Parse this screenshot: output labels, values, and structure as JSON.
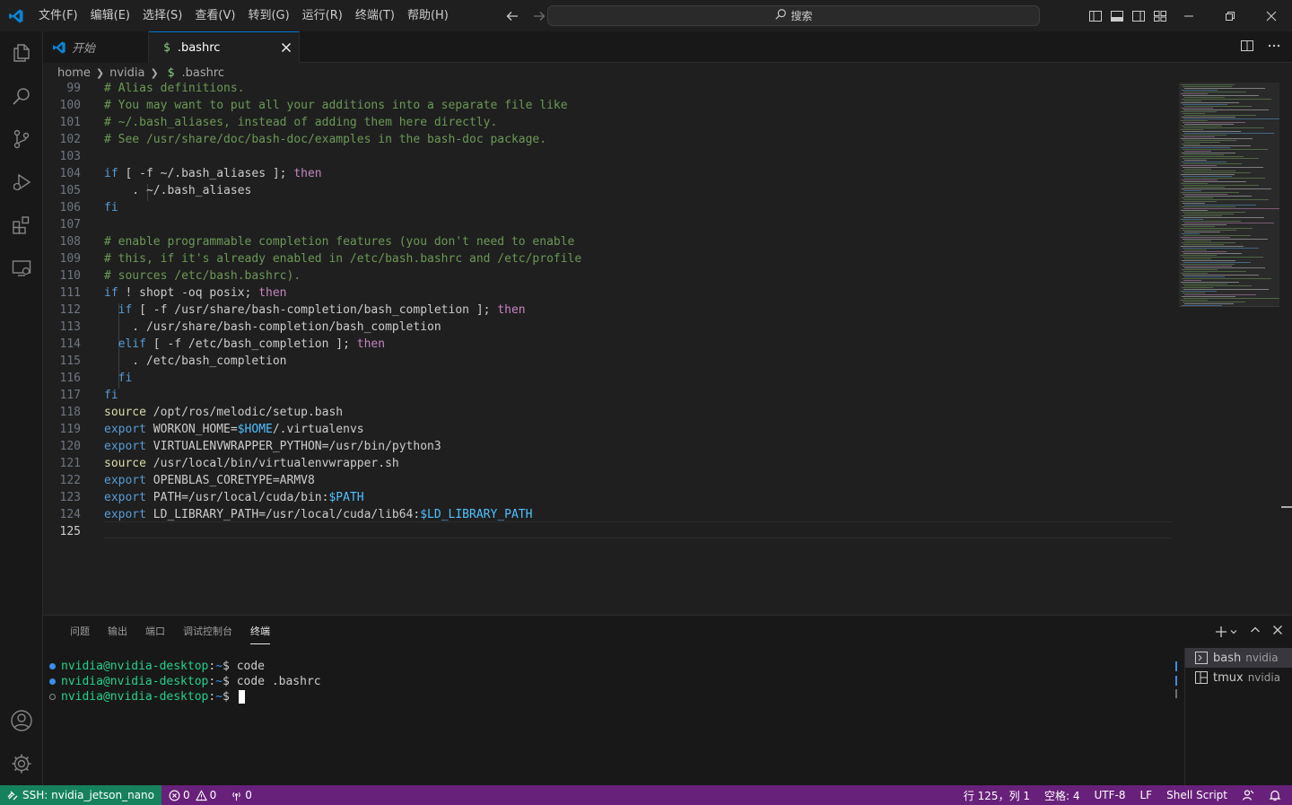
{
  "titlebar": {
    "menu": [
      "文件(F)",
      "编辑(E)",
      "选择(S)",
      "查看(V)",
      "转到(G)",
      "运行(R)",
      "终端(T)",
      "帮助(H)"
    ],
    "search_placeholder": "搜索"
  },
  "tabs": [
    {
      "label": "开始",
      "active": false
    },
    {
      "label": ".bashrc",
      "active": true,
      "icon_text": "$"
    }
  ],
  "breadcrumb": {
    "parts": [
      "home",
      "nvidia",
      ".bashrc"
    ],
    "file_icon": "$"
  },
  "editor": {
    "lines": [
      {
        "n": "99",
        "segs": [
          {
            "t": "# Alias definitions.",
            "c": "c-comment"
          }
        ]
      },
      {
        "n": "100",
        "segs": [
          {
            "t": "# You may want to put all your additions into a separate file like",
            "c": "c-comment"
          }
        ]
      },
      {
        "n": "101",
        "segs": [
          {
            "t": "# ~/.bash_aliases, instead of adding them here directly.",
            "c": "c-comment"
          }
        ]
      },
      {
        "n": "102",
        "segs": [
          {
            "t": "# See /usr/share/doc/bash-doc/examples in the bash-doc package.",
            "c": "c-comment"
          }
        ]
      },
      {
        "n": "103",
        "segs": []
      },
      {
        "n": "104",
        "segs": [
          {
            "t": "if",
            "c": "c-blue"
          },
          {
            "t": " [ -f ~/.bash_aliases ]; ",
            "c": "c-plain"
          },
          {
            "t": "then",
            "c": "c-kw"
          }
        ]
      },
      {
        "n": "105",
        "segs": [
          {
            "t": "    . ~/.bash_aliases",
            "c": "c-plain"
          }
        ]
      },
      {
        "n": "106",
        "segs": [
          {
            "t": "fi",
            "c": "c-blue"
          }
        ]
      },
      {
        "n": "107",
        "segs": []
      },
      {
        "n": "108",
        "segs": [
          {
            "t": "# enable programmable completion features (you don't need to enable",
            "c": "c-comment"
          }
        ]
      },
      {
        "n": "109",
        "segs": [
          {
            "t": "# this, if it's already enabled in /etc/bash.bashrc and /etc/profile",
            "c": "c-comment"
          }
        ]
      },
      {
        "n": "110",
        "segs": [
          {
            "t": "# sources /etc/bash.bashrc).",
            "c": "c-comment"
          }
        ]
      },
      {
        "n": "111",
        "segs": [
          {
            "t": "if",
            "c": "c-blue"
          },
          {
            "t": " ! shopt -oq posix; ",
            "c": "c-plain"
          },
          {
            "t": "then",
            "c": "c-kw"
          }
        ]
      },
      {
        "n": "112",
        "segs": [
          {
            "t": "  ",
            "c": "c-plain"
          },
          {
            "t": "if",
            "c": "c-blue"
          },
          {
            "t": " [ -f /usr/share/bash-completion/bash_completion ]; ",
            "c": "c-plain"
          },
          {
            "t": "then",
            "c": "c-kw"
          }
        ]
      },
      {
        "n": "113",
        "segs": [
          {
            "t": "    . /usr/share/bash-completion/bash_completion",
            "c": "c-plain"
          }
        ]
      },
      {
        "n": "114",
        "segs": [
          {
            "t": "  ",
            "c": "c-plain"
          },
          {
            "t": "elif",
            "c": "c-blue"
          },
          {
            "t": " [ -f /etc/bash_completion ]; ",
            "c": "c-plain"
          },
          {
            "t": "then",
            "c": "c-kw"
          }
        ]
      },
      {
        "n": "115",
        "segs": [
          {
            "t": "    . /etc/bash_completion",
            "c": "c-plain"
          }
        ]
      },
      {
        "n": "116",
        "segs": [
          {
            "t": "  ",
            "c": "c-plain"
          },
          {
            "t": "fi",
            "c": "c-blue"
          }
        ]
      },
      {
        "n": "117",
        "segs": [
          {
            "t": "fi",
            "c": "c-blue"
          }
        ]
      },
      {
        "n": "118",
        "segs": [
          {
            "t": "source",
            "c": "c-cmd"
          },
          {
            "t": " /opt/ros/melodic/setup.bash",
            "c": "c-plain"
          }
        ]
      },
      {
        "n": "119",
        "segs": [
          {
            "t": "export",
            "c": "c-blue"
          },
          {
            "t": " WORKON_HOME=",
            "c": "c-plain"
          },
          {
            "t": "$HOME",
            "c": "c-var"
          },
          {
            "t": "/.virtualenvs",
            "c": "c-plain"
          }
        ]
      },
      {
        "n": "120",
        "segs": [
          {
            "t": "export",
            "c": "c-blue"
          },
          {
            "t": " VIRTUALENVWRAPPER_PYTHON=/usr/bin/python3",
            "c": "c-plain"
          }
        ]
      },
      {
        "n": "121",
        "segs": [
          {
            "t": "source",
            "c": "c-cmd"
          },
          {
            "t": " /usr/local/bin/virtualenvwrapper.sh",
            "c": "c-plain"
          }
        ]
      },
      {
        "n": "122",
        "segs": [
          {
            "t": "export",
            "c": "c-blue"
          },
          {
            "t": " OPENBLAS_CORETYPE=ARMV8",
            "c": "c-plain"
          }
        ]
      },
      {
        "n": "123",
        "segs": [
          {
            "t": "export",
            "c": "c-blue"
          },
          {
            "t": " PATH=/usr/local/cuda/bin:",
            "c": "c-plain"
          },
          {
            "t": "$PATH",
            "c": "c-var"
          }
        ]
      },
      {
        "n": "124",
        "segs": [
          {
            "t": "export",
            "c": "c-blue"
          },
          {
            "t": " LD_LIBRARY_PATH=/usr/local/cuda/lib64:",
            "c": "c-plain"
          },
          {
            "t": "$LD_LIBRARY_PATH",
            "c": "c-var"
          }
        ]
      },
      {
        "n": "125",
        "segs": [],
        "current": true
      }
    ]
  },
  "panel": {
    "tabs": [
      {
        "label": "问题",
        "active": false
      },
      {
        "label": "输出",
        "active": false
      },
      {
        "label": "端口",
        "active": false
      },
      {
        "label": "调试控制台",
        "active": false
      },
      {
        "label": "终端",
        "active": true
      }
    ],
    "terminal_lines": [
      {
        "user": "nvidia@nvidia-desktop",
        "sep": ":",
        "path": "~",
        "prompt": "$ ",
        "cmd": "code",
        "dot": "#3b8eea",
        "dot_filled": true
      },
      {
        "user": "nvidia@nvidia-desktop",
        "sep": ":",
        "path": "~",
        "prompt": "$ ",
        "cmd": "code .bashrc",
        "dot": "#3b8eea",
        "dot_filled": true
      },
      {
        "user": "nvidia@nvidia-desktop",
        "sep": ":",
        "path": "~",
        "prompt": "$ ",
        "cmd": "",
        "dot": "#8b8b8b",
        "dot_filled": false,
        "cursor": true
      }
    ],
    "terminals": [
      {
        "name": "bash",
        "sub": "nvidia",
        "active": true,
        "icon": "terminal-icon"
      },
      {
        "name": "tmux",
        "sub": "nvidia",
        "active": false,
        "icon": "split-terminal-icon"
      }
    ]
  },
  "statusbar": {
    "remote": "SSH: nvidia_jetson_nano",
    "errors": "0",
    "warnings": "0",
    "ports": "0",
    "position": "行 125，列 1",
    "spaces": "空格: 4",
    "encoding": "UTF-8",
    "eol": "LF",
    "language": "Shell Script"
  },
  "colors": {
    "accent": "#0078d4",
    "statusbar": "#68217a",
    "remote": "#16825d",
    "comment": "#6a9955",
    "keyword": "#c586c0",
    "builtin": "#569cd6"
  }
}
